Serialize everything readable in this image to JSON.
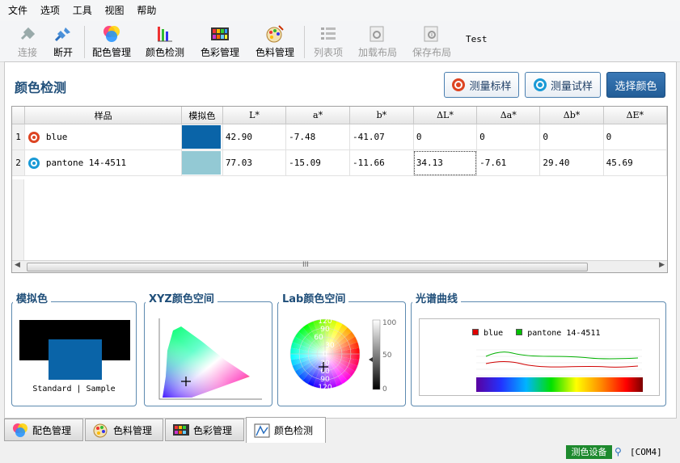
{
  "menu": [
    "文件",
    "选项",
    "工具",
    "视图",
    "帮助"
  ],
  "toolbar": {
    "items": [
      "连接",
      "断开",
      "配色管理",
      "颜色检测",
      "色彩管理",
      "色料管理",
      "列表项",
      "加载布局",
      "保存布局"
    ],
    "test_label": "Test"
  },
  "page": {
    "title": "颜色检测",
    "buttons": {
      "measure_standard": "测量标样",
      "measure_sample": "测量试样",
      "select_color": "选择颜色"
    }
  },
  "table": {
    "headers": [
      "样品",
      "模拟色",
      "L*",
      "a*",
      "b*",
      "ΔL*",
      "Δa*",
      "Δb*",
      "ΔE*"
    ],
    "rows": [
      {
        "index": "1",
        "name": "blue",
        "swatch": "#0a64a8",
        "values": [
          "42.90",
          "-7.48",
          "-41.07",
          "0",
          "0",
          "0",
          "0"
        ]
      },
      {
        "index": "2",
        "name": "pantone 14-4511",
        "swatch": "#93c9d4",
        "values": [
          "77.03",
          "-15.09",
          "-11.66",
          "34.13",
          "-7.61",
          "29.40",
          "45.69"
        ]
      }
    ],
    "scroll_grip": "III"
  },
  "panels": {
    "sim_title": "模拟色",
    "sim_label": "Standard | Sample",
    "xyz_title": "XYZ颜色空间",
    "lab_title": "Lab颜色空间",
    "spectrum_title": "光谱曲线",
    "lab_scale": [
      "100",
      "50",
      "0"
    ],
    "lab_rings": [
      "120",
      "90",
      "60",
      "30",
      "0",
      "30",
      "60",
      "90",
      "120"
    ],
    "spectrum_legend": [
      "blue",
      "pantone 14-4511"
    ]
  },
  "tabs": [
    "配色管理",
    "色料管理",
    "色彩管理",
    "颜色检测"
  ],
  "status": {
    "device": "测色设备",
    "port": "[COM4]"
  },
  "colors": {
    "standard": "#0a64a8",
    "sample": "#0a64a8",
    "accent": "#1f4e79",
    "legend_blue": "#e00000",
    "legend_pantone": "#00c000"
  }
}
